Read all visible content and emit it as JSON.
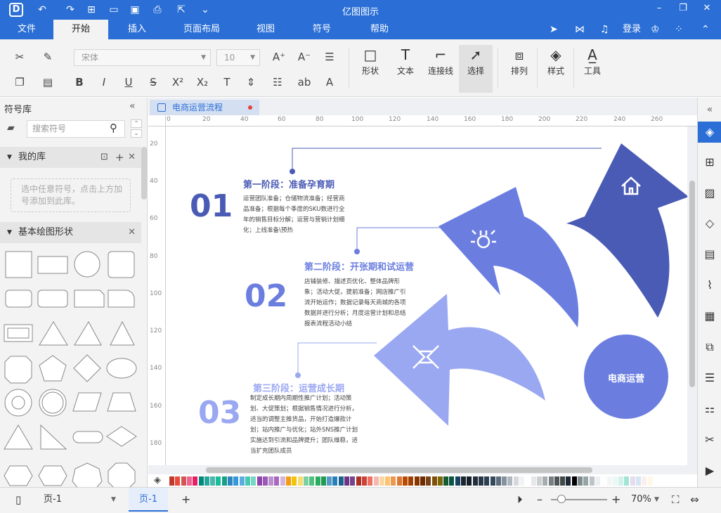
{
  "app": {
    "title": "亿图图示"
  },
  "menu": {
    "items": [
      "文件",
      "开始",
      "插入",
      "页面布局",
      "视图",
      "符号",
      "帮助"
    ],
    "active": "开始",
    "login": "登录"
  },
  "ribbon": {
    "font": "宋体",
    "size": "10",
    "shape": "形状",
    "text": "文本",
    "connector": "连接线",
    "select": "选择",
    "arrange": "排列",
    "style": "样式",
    "tools": "工具"
  },
  "library": {
    "title": "符号库",
    "search_placeholder": "搜索符号",
    "my_lib": "我的库",
    "dropzone": "选中任意符号，点击上方加号添加到此库。",
    "basic": "基本绘图形状"
  },
  "document": {
    "tab": "电商运营流程"
  },
  "ruler_h": [
    "0",
    "20",
    "40",
    "60",
    "80",
    "100",
    "120",
    "140",
    "160",
    "180",
    "200",
    "220",
    "240",
    "260"
  ],
  "ruler_v": [
    "20",
    "40",
    "60",
    "80",
    "100",
    "120",
    "140",
    "160",
    "180"
  ],
  "diagram": {
    "stage1": {
      "num": "01",
      "title": "第一阶段：准备孕育期",
      "desc": "运营团队准备；仓储物流准备；经营商品准备；根据每个季度的SKU数进行全年的销售目标分解；运营与营销计划细化；上线准备\\预热"
    },
    "stage2": {
      "num": "02",
      "title": "第二阶段：开张期和试运营",
      "desc": "店铺装修、描述页优化、整体品牌形象；活动大促，提前准备；网店推广引流开始运作；数据记录每天商城的各项数据并进行分析；月度运营计划和总结报表流程活动小结"
    },
    "stage3": {
      "num": "03",
      "title": "第三阶段：运营成长期",
      "desc": "制定成长期内周期性推广计划；活动策划、大促策划；根据销售情况进行分析，适当的调整主推货品，开始打造爆款计划；站内推广与优化；站外SNS推广计划实施达到引流和品牌提升；团队维稳，适当扩充团队成员"
    },
    "center": "电商运营"
  },
  "status": {
    "page_select": "页-1",
    "page_tab": "页-1",
    "zoom": "70%"
  },
  "colors": {
    "brand": "#2b6fd6",
    "stage1": "#4a5bb5",
    "stage2": "#6b7ee0",
    "stage3": "#9aa8f2"
  }
}
